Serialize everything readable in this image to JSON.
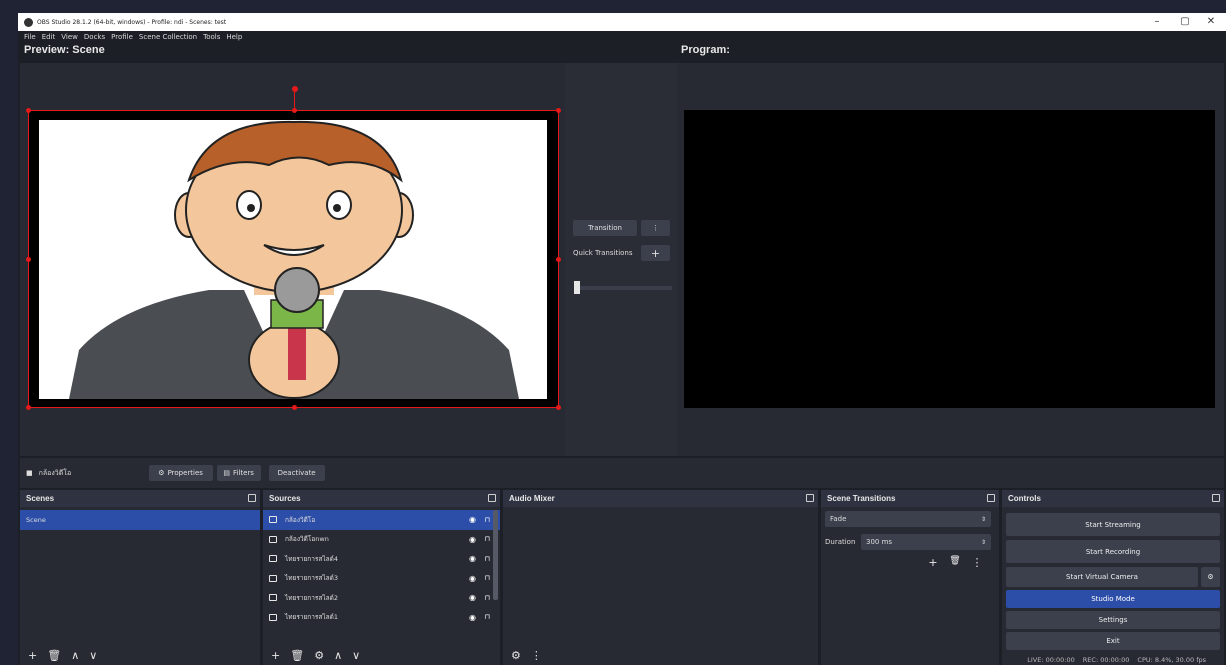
{
  "window": {
    "title": "OBS Studio 28.1.2 (64-bit, windows) - Profile: ndi - Scenes: test",
    "min": "–",
    "max": "▢",
    "close": "✕"
  },
  "menu": [
    "File",
    "Edit",
    "View",
    "Docks",
    "Profile",
    "Scene Collection",
    "Tools",
    "Help"
  ],
  "preview": {
    "label": "Preview: Scene"
  },
  "program": {
    "label": "Program:"
  },
  "transition": {
    "button": "Transition",
    "more": "⋮",
    "quick_label": "Quick Transitions",
    "add": "+"
  },
  "source_toolbar": {
    "source_name": "กล้องวิดีโอ",
    "properties": "Properties",
    "filters": "Filters",
    "deactivate": "Deactivate"
  },
  "scenes": {
    "title": "Scenes",
    "items": [
      "Scene"
    ],
    "buttons": [
      "+",
      "🗑",
      "∧",
      "∨"
    ]
  },
  "sources": {
    "title": "Sources",
    "items": [
      {
        "name": "กล้องวิดีโอ",
        "selected": true
      },
      {
        "name": "กล้องวิดีโอnwn",
        "selected": false
      },
      {
        "name": "ไทยรายการสไลด์4",
        "selected": false
      },
      {
        "name": "ไทยรายการสไลด์3",
        "selected": false
      },
      {
        "name": "ไทยรายการสไลด์2",
        "selected": false
      },
      {
        "name": "ไทยรายการสไลด์1",
        "selected": false
      }
    ],
    "buttons": [
      "+",
      "🗑",
      "⚙",
      "∧",
      "∨"
    ]
  },
  "audio_mixer": {
    "title": "Audio Mixer",
    "buttons": [
      "⚙",
      "⋮"
    ]
  },
  "scene_transitions": {
    "title": "Scene Transitions",
    "selected": "Fade",
    "duration_label": "Duration",
    "duration_value": "300 ms",
    "buttons": [
      "+",
      "🗑",
      "⋮"
    ]
  },
  "controls": {
    "title": "Controls",
    "start_streaming": "Start Streaming",
    "start_recording": "Start Recording",
    "start_virtual_camera": "Start Virtual Camera",
    "studio_mode": "Studio Mode",
    "settings": "Settings",
    "exit": "Exit"
  },
  "status": {
    "live": "LIVE: 00:00:00",
    "rec": "REC: 00:00:00",
    "cpu": "CPU: 8.4%, 30.00 fps"
  },
  "colors": {
    "accent": "#2c4ea8",
    "selection_red": "#e41919"
  }
}
